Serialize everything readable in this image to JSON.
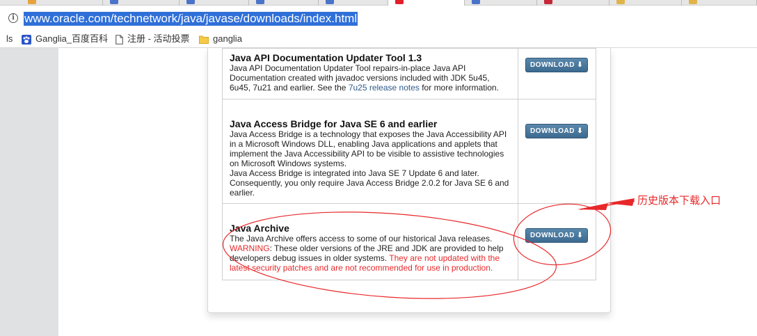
{
  "browser": {
    "address_url": "www.oracle.com/technetwork/java/javase/downloads/index.html",
    "bookmarks": [
      {
        "label": "ls",
        "icon": "none"
      },
      {
        "label": "Ganglia_百度百科",
        "icon": "baidu-paw-icon"
      },
      {
        "label": "注册 - 活动投票",
        "icon": "page-icon"
      },
      {
        "label": "ganglia",
        "icon": "folder-icon"
      }
    ]
  },
  "items": [
    {
      "title": "Java API Documentation Updater Tool 1.3",
      "desc_lines": [
        "Java API Documentation Updater Tool repairs-in-place Java API",
        "Documentation created with javadoc versions included with JDK 5u45,"
      ],
      "desc_last_prefix": "6u45, 7u21 and earlier.  See the ",
      "desc_link": "7u25 release notes",
      "desc_last_suffix": " for more information.",
      "button": "DOWNLOAD"
    },
    {
      "title": "Java Access Bridge for Java SE 6 and earlier",
      "desc_lines": [
        "Java Access Bridge is a technology that exposes the Java Accessibility API",
        "in a Microsoft Windows DLL, enabling Java applications and applets that",
        "implement the Java Accessibility API to be visible to assistive technologies",
        "on Microsoft Windows systems.",
        "Java Access Bridge is integrated into Java SE 7 Update 6 and later.",
        "Consequently, you only require Java Access Bridge 2.0.2 for Java SE 6 and",
        "earlier."
      ],
      "button": "DOWNLOAD"
    },
    {
      "title": "Java Archive",
      "desc_line1": "The Java Archive offers access to some of our historical Java releases.",
      "warning_label": "WARNING",
      "warning_line1_rest": ": These older versions of the JRE and JDK are provided to help",
      "warning_line2_normal": "developers debug issues in older systems. ",
      "warning_line2_red": "They are not updated with the",
      "warning_line3_red": "latest security patches and are not recommended for use in production.",
      "button": "DOWNLOAD"
    }
  ],
  "annotation": {
    "label": "历史版本下载入口",
    "color": "#e8282a"
  },
  "colors": {
    "button_bg": "#4a7aa0",
    "link": "#2d5a8a",
    "warning": "#e8282a",
    "url_highlight": "#2f6fd8"
  }
}
